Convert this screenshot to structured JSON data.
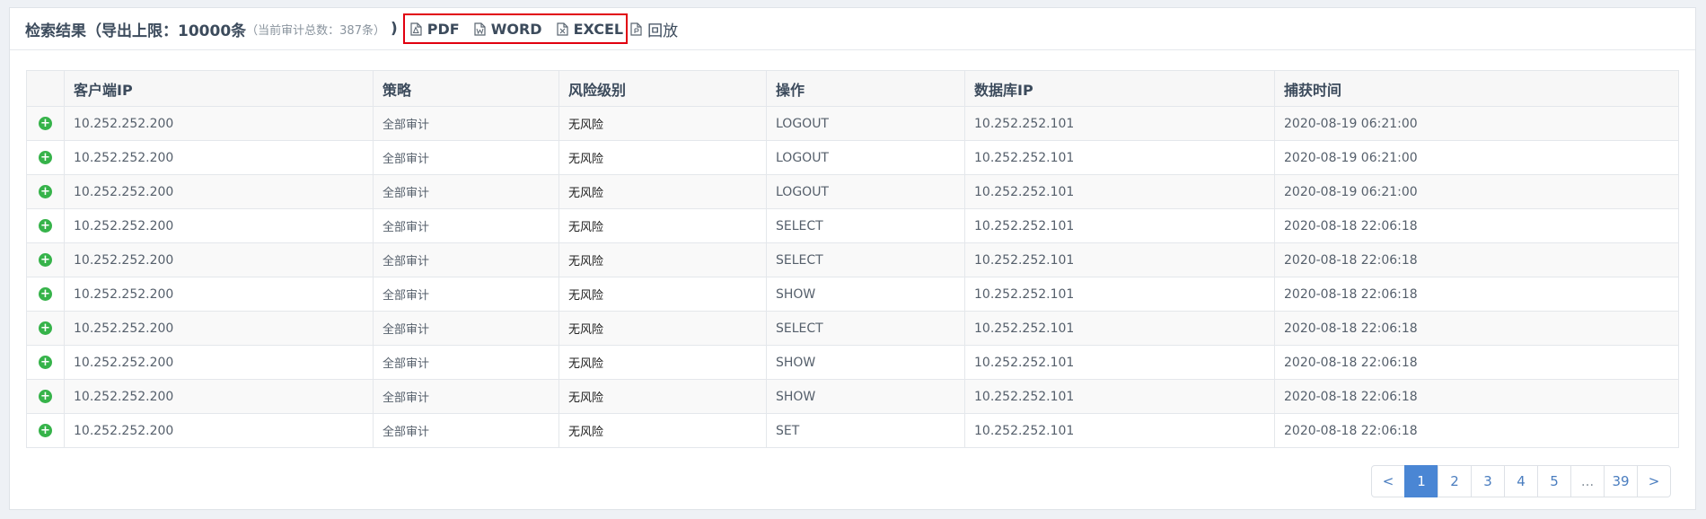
{
  "header": {
    "title": "检索结果（导出上限：10000条",
    "note": "（当前审计总数：387条）",
    "close_paren": ")",
    "exports": [
      {
        "label": "PDF",
        "icon": "pdf-file-icon"
      },
      {
        "label": "WORD",
        "icon": "word-file-icon"
      },
      {
        "label": "EXCEL",
        "icon": "excel-file-icon"
      }
    ],
    "replay": {
      "label": "回放",
      "icon": "replay-file-icon"
    }
  },
  "table": {
    "columns": [
      "客户端IP",
      "策略",
      "风险级别",
      "操作",
      "数据库IP",
      "捕获时间"
    ],
    "rows": [
      {
        "client_ip": "10.252.252.200",
        "policy": "全部审计",
        "risk": "无风险",
        "operation": "LOGOUT",
        "db_ip": "10.252.252.101",
        "time": "2020-08-19 06:21:00"
      },
      {
        "client_ip": "10.252.252.200",
        "policy": "全部审计",
        "risk": "无风险",
        "operation": "LOGOUT",
        "db_ip": "10.252.252.101",
        "time": "2020-08-19 06:21:00"
      },
      {
        "client_ip": "10.252.252.200",
        "policy": "全部审计",
        "risk": "无风险",
        "operation": "LOGOUT",
        "db_ip": "10.252.252.101",
        "time": "2020-08-19 06:21:00"
      },
      {
        "client_ip": "10.252.252.200",
        "policy": "全部审计",
        "risk": "无风险",
        "operation": "SELECT",
        "db_ip": "10.252.252.101",
        "time": "2020-08-18 22:06:18"
      },
      {
        "client_ip": "10.252.252.200",
        "policy": "全部审计",
        "risk": "无风险",
        "operation": "SELECT",
        "db_ip": "10.252.252.101",
        "time": "2020-08-18 22:06:18"
      },
      {
        "client_ip": "10.252.252.200",
        "policy": "全部审计",
        "risk": "无风险",
        "operation": "SHOW",
        "db_ip": "10.252.252.101",
        "time": "2020-08-18 22:06:18"
      },
      {
        "client_ip": "10.252.252.200",
        "policy": "全部审计",
        "risk": "无风险",
        "operation": "SELECT",
        "db_ip": "10.252.252.101",
        "time": "2020-08-18 22:06:18"
      },
      {
        "client_ip": "10.252.252.200",
        "policy": "全部审计",
        "risk": "无风险",
        "operation": "SHOW",
        "db_ip": "10.252.252.101",
        "time": "2020-08-18 22:06:18"
      },
      {
        "client_ip": "10.252.252.200",
        "policy": "全部审计",
        "risk": "无风险",
        "operation": "SHOW",
        "db_ip": "10.252.252.101",
        "time": "2020-08-18 22:06:18"
      },
      {
        "client_ip": "10.252.252.200",
        "policy": "全部审计",
        "risk": "无风险",
        "operation": "SET",
        "db_ip": "10.252.252.101",
        "time": "2020-08-18 22:06:18"
      }
    ],
    "expand_icon": "plus-circle-icon",
    "expand_glyph": "+"
  },
  "pagination": {
    "prev": "<",
    "pages": [
      "1",
      "2",
      "3",
      "4",
      "5"
    ],
    "ellipsis": "...",
    "last": "39",
    "next": ">",
    "current": "1"
  },
  "colors": {
    "export_box_border": "#e1000f",
    "expand_icon": "#36b34a",
    "active_page": "#4a86d4"
  }
}
